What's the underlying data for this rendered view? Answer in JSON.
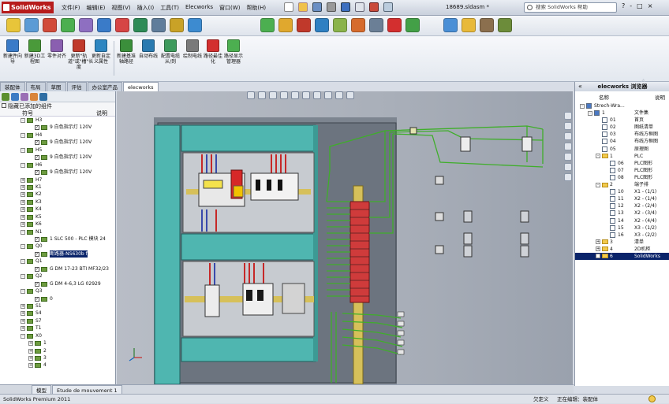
{
  "app": {
    "logo_text": "SolidWorks",
    "doc_title": "18689.sldasm *",
    "search_placeholder": "搜索 SolidWorks 帮助",
    "menus": [
      "文件(F)",
      "编辑(E)",
      "视图(V)",
      "插入(I)",
      "工具(T)",
      "Elecworks",
      "窗口(W)",
      "帮助(H)"
    ],
    "win_controls": [
      "?",
      "-",
      "□",
      "×"
    ]
  },
  "ribbon": {
    "buttons": [
      {
        "label": "新建件向导",
        "color": "#3a7bc8"
      },
      {
        "label": "新建3D工程图",
        "color": "#4a9a3a"
      },
      {
        "label": "零件对齐",
        "color": "#8a5fb0"
      },
      {
        "label": "更新\"轨道\"或\"槽\"长度",
        "color": "#c0392b"
      },
      {
        "label": "更新自定义属性",
        "color": "#2e86c1"
      },
      {
        "label": "新建基准轴路径",
        "color": "#3b8f3b"
      },
      {
        "label": "自动布线",
        "color": "#2a7ab0"
      },
      {
        "label": "配置电缆从/到",
        "color": "#3d9a5c"
      },
      {
        "label": "绘制电线",
        "color": "#7a7a7a"
      },
      {
        "label": "路径最佳化",
        "color": "#d32f2f"
      },
      {
        "label": "路径显示管理器",
        "color": "#4caf50"
      }
    ]
  },
  "tabs": [
    "装配体",
    "布局",
    "草图",
    "评估",
    "办公室产品",
    "elecworks"
  ],
  "active_tab_index": 5,
  "left_panel": {
    "header_text": "隐藏已添加的组件",
    "col1": "符号",
    "col2": "说明",
    "rows": [
      {
        "indent": 1,
        "exp": "-",
        "label": "H3",
        "checkbox": false
      },
      {
        "indent": 2,
        "exp": "",
        "label": "9 白色指示灯 120V",
        "checkbox": true
      },
      {
        "indent": 1,
        "exp": "-",
        "label": "H4",
        "checkbox": false
      },
      {
        "indent": 2,
        "exp": "",
        "label": "9 白色指示灯 120V",
        "checkbox": true
      },
      {
        "indent": 1,
        "exp": "-",
        "label": "H5",
        "checkbox": false
      },
      {
        "indent": 2,
        "exp": "",
        "label": "9 白色指示灯 120V",
        "checkbox": true
      },
      {
        "indent": 1,
        "exp": "-",
        "label": "H6",
        "checkbox": false
      },
      {
        "indent": 2,
        "exp": "",
        "label": "9 白色指示灯 120V",
        "checkbox": true
      },
      {
        "indent": 1,
        "exp": "+",
        "label": "H7",
        "checkbox": false
      },
      {
        "indent": 1,
        "exp": "+",
        "label": "K1",
        "checkbox": false
      },
      {
        "indent": 1,
        "exp": "+",
        "label": "K2",
        "checkbox": false
      },
      {
        "indent": 1,
        "exp": "+",
        "label": "K3",
        "checkbox": false
      },
      {
        "indent": 1,
        "exp": "+",
        "label": "K4",
        "checkbox": false
      },
      {
        "indent": 1,
        "exp": "+",
        "label": "K5",
        "checkbox": false
      },
      {
        "indent": 1,
        "exp": "+",
        "label": "K6",
        "checkbox": false
      },
      {
        "indent": 1,
        "exp": "-",
        "label": "N1",
        "checkbox": false
      },
      {
        "indent": 2,
        "exp": "",
        "label": "1 SLC 500 - PLC 模块 24",
        "checkbox": true
      },
      {
        "indent": 1,
        "exp": "-",
        "label": "Q0",
        "checkbox": false
      },
      {
        "indent": 2,
        "exp": "",
        "label": "断路器-NS630b f",
        "checkbox": true,
        "selected": true
      },
      {
        "indent": 1,
        "exp": "-",
        "label": "Q1",
        "checkbox": false
      },
      {
        "indent": 2,
        "exp": "",
        "label": "G DM 17-23 BTI MF32/23",
        "checkbox": true
      },
      {
        "indent": 1,
        "exp": "-",
        "label": "Q2",
        "checkbox": false
      },
      {
        "indent": 2,
        "exp": "",
        "label": "G DM 4-6,3 LG 02929",
        "checkbox": true
      },
      {
        "indent": 1,
        "exp": "-",
        "label": "Q3",
        "checkbox": false
      },
      {
        "indent": 2,
        "exp": "",
        "label": "0",
        "checkbox": true
      },
      {
        "indent": 1,
        "exp": "+",
        "label": "S1",
        "checkbox": false
      },
      {
        "indent": 1,
        "exp": "+",
        "label": "S4",
        "checkbox": false
      },
      {
        "indent": 1,
        "exp": "+",
        "label": "S7",
        "checkbox": false
      },
      {
        "indent": 1,
        "exp": "+",
        "label": "T1",
        "checkbox": false
      },
      {
        "indent": 1,
        "exp": "-",
        "label": "X0",
        "checkbox": false
      },
      {
        "indent": 2,
        "exp": "+",
        "label": "1",
        "checkbox": false
      },
      {
        "indent": 2,
        "exp": "+",
        "label": "2",
        "checkbox": false
      },
      {
        "indent": 2,
        "exp": "+",
        "label": "3",
        "checkbox": false
      },
      {
        "indent": 2,
        "exp": "+",
        "label": "4",
        "checkbox": false
      }
    ]
  },
  "right_panel": {
    "title": "elecworks 浏览器",
    "col_name": "名称",
    "col_desc": "说明",
    "rows": [
      {
        "indent": 0,
        "exp": "-",
        "icon": "root",
        "name": "Strech-Wra...",
        "desc": ""
      },
      {
        "indent": 1,
        "exp": "-",
        "icon": "book",
        "name": "1",
        "desc": "文件集"
      },
      {
        "indent": 2,
        "exp": "",
        "icon": "page",
        "name": "01",
        "desc": "首页"
      },
      {
        "indent": 2,
        "exp": "",
        "icon": "page",
        "name": "02",
        "desc": "图纸清单"
      },
      {
        "indent": 2,
        "exp": "",
        "icon": "page",
        "name": "03",
        "desc": "布线方框图"
      },
      {
        "indent": 2,
        "exp": "",
        "icon": "page",
        "name": "04",
        "desc": "布线方框图"
      },
      {
        "indent": 2,
        "exp": "",
        "icon": "page",
        "name": "05",
        "desc": "原理图"
      },
      {
        "indent": 2,
        "exp": "-",
        "icon": "folder",
        "name": "1",
        "desc": "PLC"
      },
      {
        "indent": 3,
        "exp": "",
        "icon": "page",
        "name": "06",
        "desc": "PLC图形"
      },
      {
        "indent": 3,
        "exp": "",
        "icon": "page",
        "name": "07",
        "desc": "PLC图形"
      },
      {
        "indent": 3,
        "exp": "",
        "icon": "page",
        "name": "08",
        "desc": "PLC图形"
      },
      {
        "indent": 2,
        "exp": "-",
        "icon": "folder",
        "name": "2",
        "desc": "端子排"
      },
      {
        "indent": 3,
        "exp": "",
        "icon": "page",
        "name": "10",
        "desc": "X1 - (1/1)"
      },
      {
        "indent": 3,
        "exp": "",
        "icon": "page",
        "name": "11",
        "desc": "X2 - (1/4)"
      },
      {
        "indent": 3,
        "exp": "",
        "icon": "page",
        "name": "12",
        "desc": "X2 - (2/4)"
      },
      {
        "indent": 3,
        "exp": "",
        "icon": "page",
        "name": "13",
        "desc": "X2 - (3/4)"
      },
      {
        "indent": 3,
        "exp": "",
        "icon": "page",
        "name": "14",
        "desc": "X2 - (4/4)"
      },
      {
        "indent": 3,
        "exp": "",
        "icon": "page",
        "name": "15",
        "desc": "X3 - (1/2)"
      },
      {
        "indent": 3,
        "exp": "",
        "icon": "page",
        "name": "16",
        "desc": "X3 - (2/2)"
      },
      {
        "indent": 2,
        "exp": "+",
        "icon": "folder",
        "name": "3",
        "desc": "清单"
      },
      {
        "indent": 2,
        "exp": "+",
        "icon": "folder",
        "name": "4",
        "desc": "2D机柜"
      },
      {
        "indent": 2,
        "exp": "+",
        "icon": "folder",
        "name": "6",
        "desc": "SolidWorks",
        "selected": true
      }
    ]
  },
  "bottom_tabs": [
    "模型",
    "Etude de mouvement 1"
  ],
  "status": {
    "left": "SolidWorks Premium 2011",
    "undefined": "欠定义",
    "editing": "正在编辑：装配体"
  }
}
